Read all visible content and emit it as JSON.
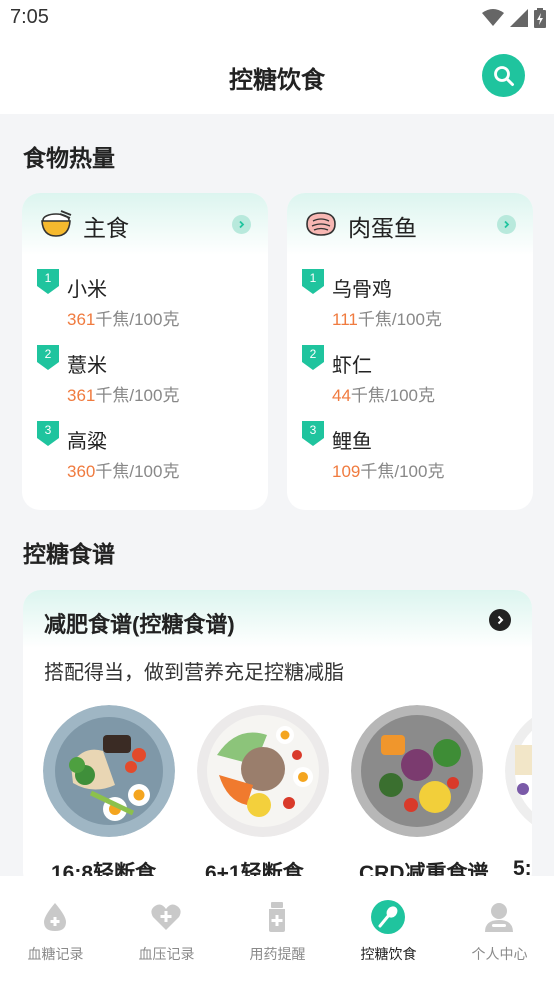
{
  "status_bar": {
    "time": "7:05"
  },
  "header": {
    "title": "控糖饮食"
  },
  "sections": {
    "calories": "食物热量",
    "recipes": "控糖食谱"
  },
  "calorie_cards": [
    {
      "title": "主食",
      "icon": "rice-bowl-icon",
      "items": [
        {
          "rank": "1",
          "name": "小米",
          "kcal": "361",
          "unit": "千焦/100克"
        },
        {
          "rank": "2",
          "name": "薏米",
          "kcal": "361",
          "unit": "千焦/100克"
        },
        {
          "rank": "3",
          "name": "高粱",
          "kcal": "360",
          "unit": "千焦/100克"
        }
      ]
    },
    {
      "title": "肉蛋鱼",
      "icon": "meat-icon",
      "items": [
        {
          "rank": "1",
          "name": "乌骨鸡",
          "kcal": "111",
          "unit": "千焦/100克"
        },
        {
          "rank": "2",
          "name": "虾仁",
          "kcal": "44",
          "unit": "千焦/100克"
        },
        {
          "rank": "3",
          "name": "鲤鱼",
          "kcal": "109",
          "unit": "千焦/100克"
        }
      ]
    }
  ],
  "recipe_card": {
    "title": "减肥食谱(控糖食谱)",
    "subtitle": "搭配得当，做到营养充足控糖减脂",
    "dishes": [
      {
        "name": "16:8轻断食"
      },
      {
        "name": "6+1轻断食"
      },
      {
        "name": "CRD减重食谱"
      },
      {
        "name": "5:"
      }
    ]
  },
  "tabs": [
    {
      "label": "血糖记录",
      "icon": "blood-drop-plus-icon",
      "active": false
    },
    {
      "label": "血压记录",
      "icon": "heart-plus-icon",
      "active": false
    },
    {
      "label": "用药提醒",
      "icon": "medicine-bottle-icon",
      "active": false
    },
    {
      "label": "控糖饮食",
      "icon": "spoon-fork-icon",
      "active": true
    },
    {
      "label": "个人中心",
      "icon": "person-icon",
      "active": false
    }
  ],
  "colors": {
    "accent": "#1fc49e",
    "kcal": "#f07b3f",
    "inactive_tab": "#8a8a8a"
  }
}
